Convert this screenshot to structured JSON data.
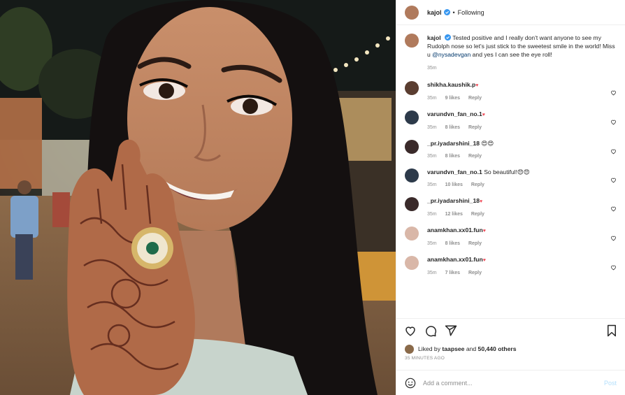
{
  "post": {
    "author": "kajol",
    "separator": "•",
    "follow_status": "Following",
    "caption_text": "Tested positive and I really don't want anyone to see my Rudolph nose so let's just stick to the sweetest smile in the world! Miss u",
    "caption_mention": "@nysadevgan",
    "caption_tail": "and yes I can see the eye roll!",
    "caption_time": "35m"
  },
  "comments": [
    {
      "user": "shikha.kaushik.p",
      "text": "♥",
      "time": "35m",
      "likes": "9 likes",
      "reply": "Reply"
    },
    {
      "user": "varundvn_fan_no.1",
      "text": "♥",
      "time": "35m",
      "likes": "8 likes",
      "reply": "Reply"
    },
    {
      "user": "_pr.iyadarshini_18",
      "text": "😍😍",
      "time": "35m",
      "likes": "8 likes",
      "reply": "Reply"
    },
    {
      "user": "varundvn_fan_no.1",
      "text": "So beautiful!😍😍",
      "time": "35m",
      "likes": "10 likes",
      "reply": "Reply"
    },
    {
      "user": "_pr.iyadarshini_18",
      "text": "♥",
      "time": "35m",
      "likes": "12 likes",
      "reply": "Reply"
    },
    {
      "user": "anamkhan.xx01.fun",
      "text": "♥",
      "time": "35m",
      "likes": "8 likes",
      "reply": "Reply"
    },
    {
      "user": "anamkhan.xx01.fun",
      "text": "♥",
      "time": "35m",
      "likes": "7 likes",
      "reply": "Reply"
    }
  ],
  "likes_summary": {
    "prefix": "Liked by",
    "user": "taapsee",
    "middle": "and",
    "count": "50,440 others"
  },
  "posted_ago": "35 MINUTES AGO",
  "comment_input": {
    "placeholder": "Add a comment...",
    "value": ""
  },
  "post_button": "Post",
  "colors": {
    "link": "#00376b",
    "muted": "#8e8e8e",
    "post_button": "#b2dffc",
    "heart": "#ed4956"
  },
  "icons": [
    "verified-badge-icon",
    "heart-icon",
    "comment-icon",
    "share-icon",
    "save-icon",
    "emoji-icon"
  ]
}
